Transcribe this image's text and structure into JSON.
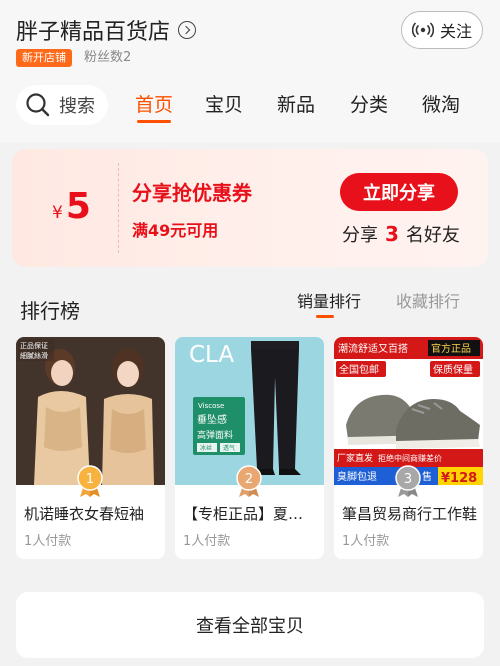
{
  "shop": {
    "name": "胖子精品百货店",
    "badge": "新开店铺",
    "fans": "粉丝数2",
    "follow_label": "关注"
  },
  "nav": {
    "search_label": "搜索",
    "tabs": [
      {
        "label": "首页",
        "active": true
      },
      {
        "label": "宝贝",
        "active": false
      },
      {
        "label": "新品",
        "active": false
      },
      {
        "label": "分类",
        "active": false
      },
      {
        "label": "微淘",
        "active": false
      }
    ]
  },
  "coupon": {
    "currency": "¥",
    "amount": "5",
    "title": "分享抢优惠券",
    "condition": "满49元可用",
    "share_button": "立即分享",
    "share_prefix": "分享",
    "share_count": "3",
    "share_suffix": "名好友"
  },
  "ranking": {
    "title": "排行榜",
    "tabs": [
      {
        "label": "销量排行",
        "active": true
      },
      {
        "label": "收藏排行",
        "active": false
      }
    ],
    "items": [
      {
        "rank": "1",
        "title": "机诺睡衣女春短袖",
        "sold": "1人付款",
        "image_text": [
          "正品保证",
          "細膩絲滑"
        ]
      },
      {
        "rank": "2",
        "title": "【专柜正品】夏季男裤",
        "sold": "1人付款",
        "image_text": [
          "CLA",
          "Viscose",
          "垂坠感",
          "高弹面料",
          "冰丝",
          "透气"
        ]
      },
      {
        "rank": "3",
        "title": "筆昌贸易商行工作鞋",
        "sold": "1人付款",
        "image_text": [
          "潮流舒适又百搭",
          "官方正品",
          "全国包邮",
          "保质保量",
          "厂家直发",
          "拒绝中间商赚差价",
          "臭脚包退",
          "2",
          "售",
          "¥128"
        ]
      }
    ]
  },
  "footer": {
    "view_all": "查看全部宝贝"
  },
  "colors": {
    "accent": "#ff5000",
    "coupon_red": "#e8101a",
    "badge_orange": "#ff6a1a"
  }
}
